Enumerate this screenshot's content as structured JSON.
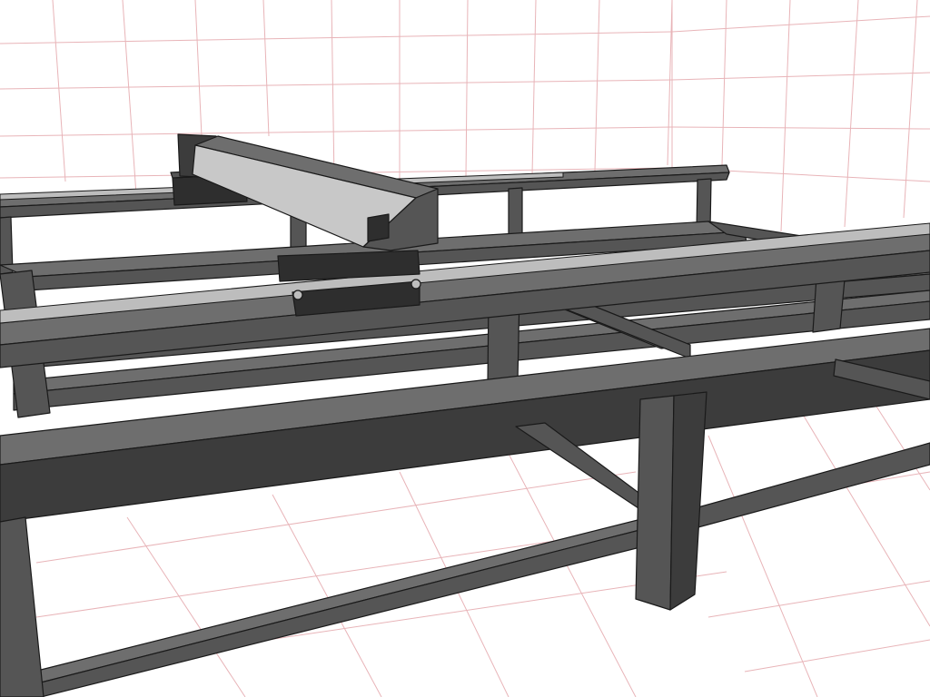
{
  "viewport": {
    "background": "#ffffff",
    "grid_color": "#e8b4b8",
    "stroke_color": "#1a1a1a"
  },
  "materials": {
    "frame_top": "#6e6e6e",
    "frame_side": "#555555",
    "frame_dark": "#3c3c3c",
    "rail_light": "#bdbdbd",
    "gantry_light": "#c8c8c8",
    "carriage_dark": "#2e2e2e"
  }
}
